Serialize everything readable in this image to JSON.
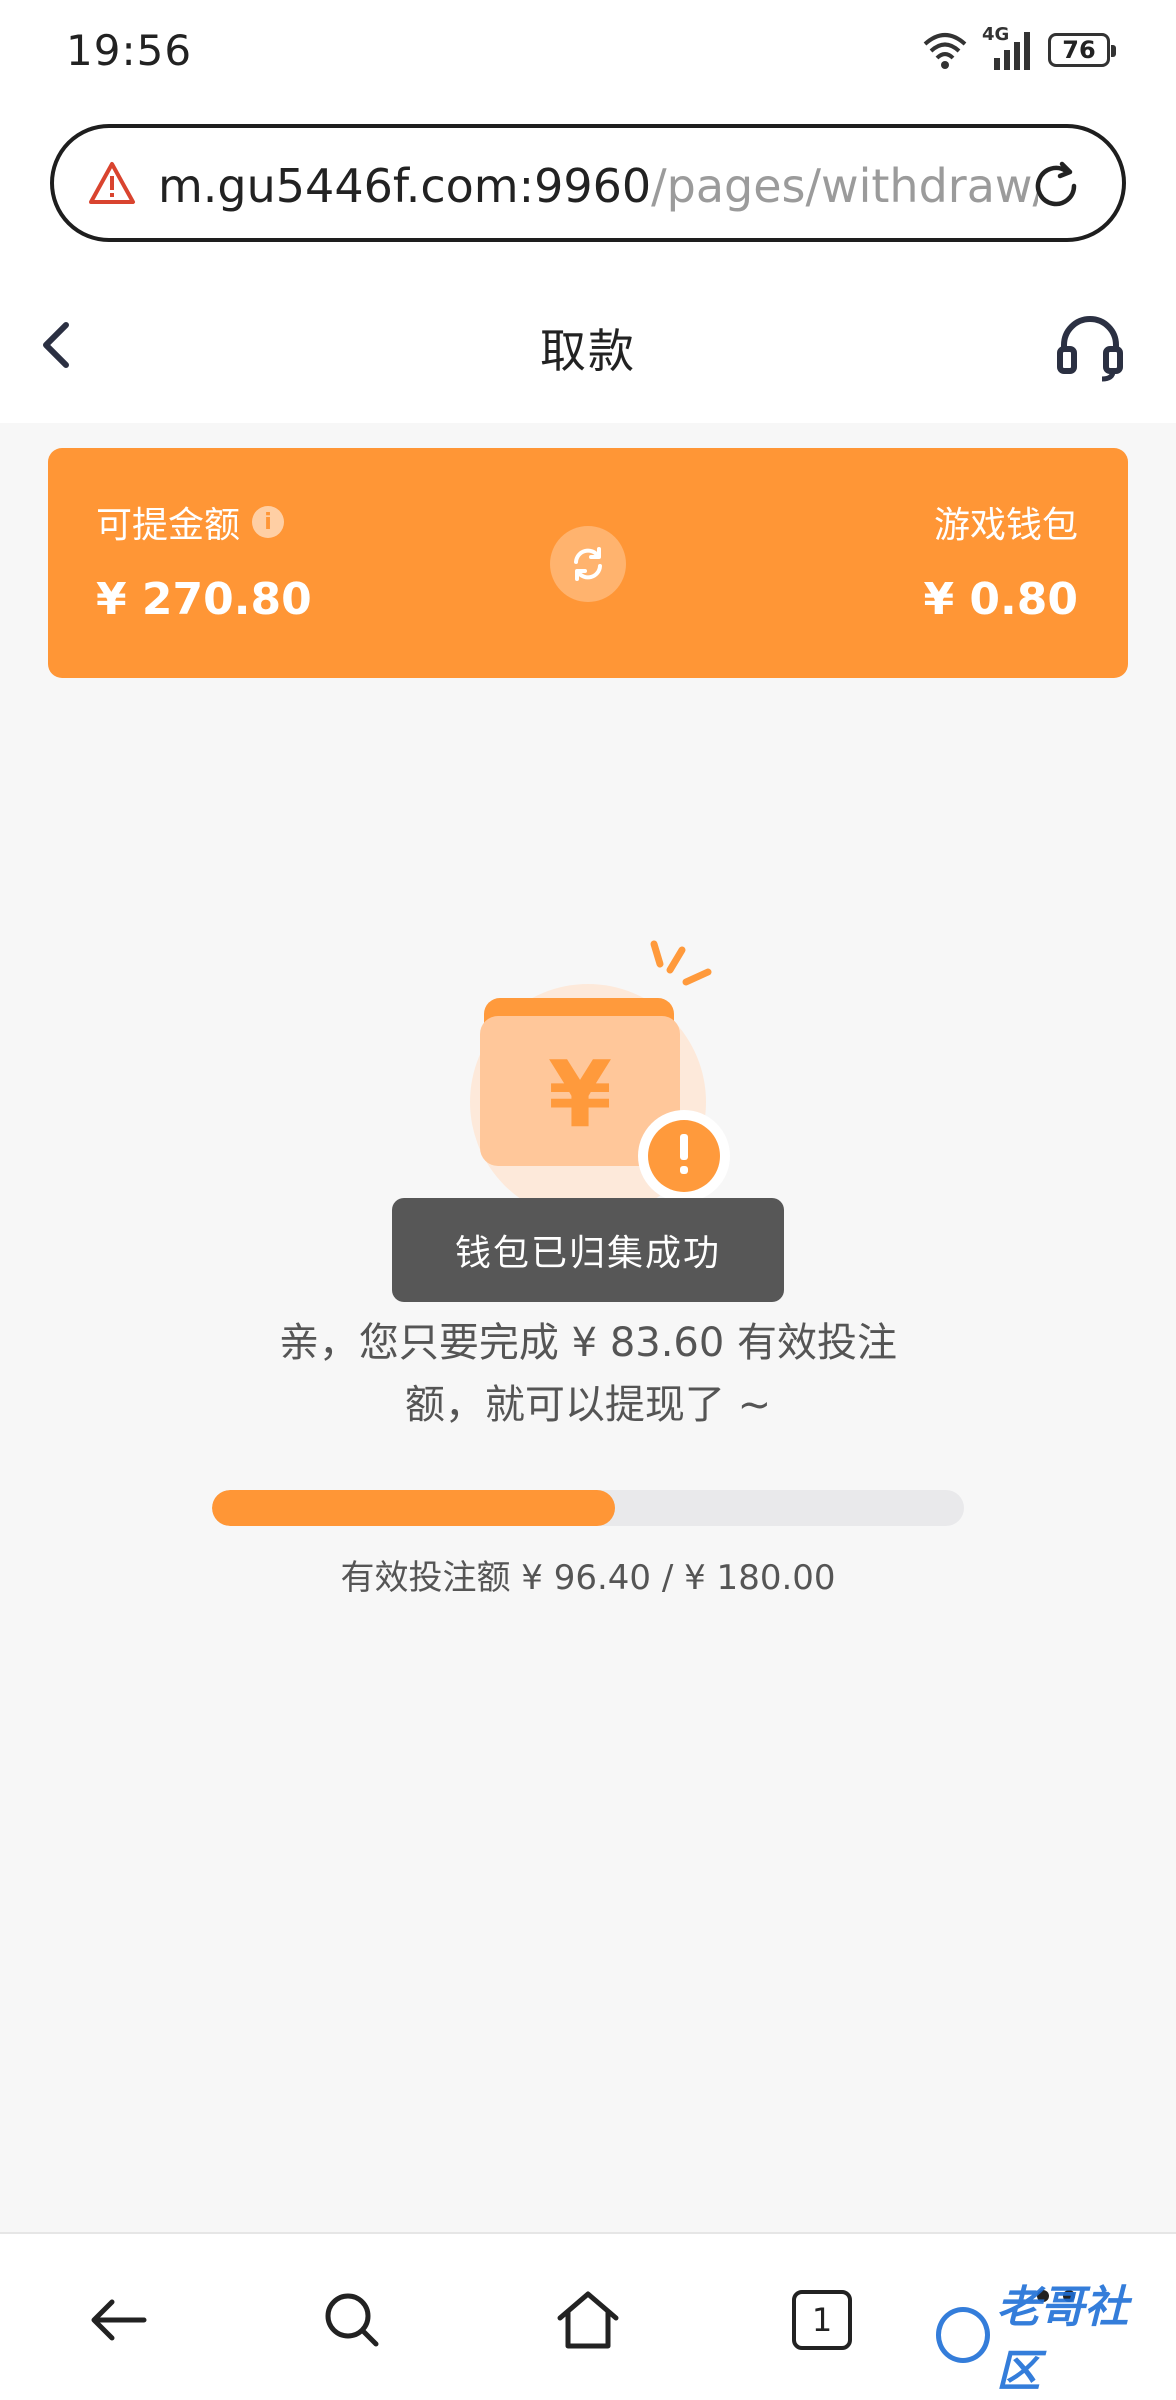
{
  "status_bar": {
    "time": "19:56",
    "network": "4G",
    "battery": "76",
    "icons": [
      "wifi-icon",
      "signal-icon",
      "battery-icon"
    ]
  },
  "browser": {
    "url_domain": "m.gu5446f.com:9960",
    "url_path": "/pages/withdraw/",
    "icons": [
      "warning-icon",
      "reload-icon"
    ]
  },
  "header": {
    "title": "取款",
    "icons": [
      "back-icon",
      "headset-icon"
    ]
  },
  "balance_card": {
    "withdrawable_label": "可提金额",
    "withdrawable_value": "¥ 270.80",
    "game_wallet_label": "游戏钱包",
    "game_wallet_value": "¥ 0.80",
    "accent_color": "#ff9636"
  },
  "toast": {
    "text": "钱包已归集成功"
  },
  "message": {
    "line1": "亲，您只要完成 ¥ 83.60 有效投注",
    "line2": "额，就可以提现了 ~"
  },
  "progress": {
    "current": 96.4,
    "target": 180.0,
    "fraction": 0.5356,
    "caption": "有效投注额 ¥ 96.40 / ¥ 180.00"
  },
  "bottom_nav": {
    "tab_count": "1",
    "icons": [
      "nav-back-icon",
      "nav-search-icon",
      "nav-home-icon",
      "tabs-icon",
      "menu-icon"
    ]
  },
  "watermark": {
    "text": "老哥社区"
  }
}
